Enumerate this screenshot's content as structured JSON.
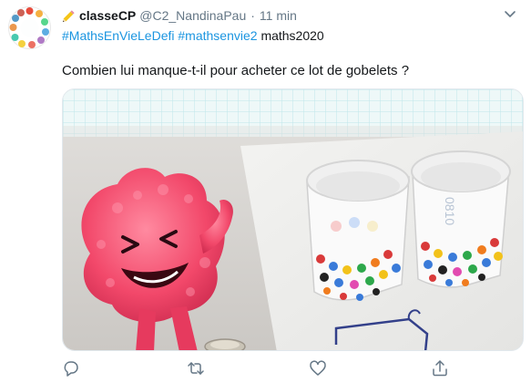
{
  "tweet": {
    "display_name": "classeCP",
    "handle": "@C2_NandinaPau",
    "separator": "·",
    "time": "11 min",
    "hashtags": [
      "#MathsEnVieLeDefi",
      "#mathsenvie2",
      "maths2020"
    ],
    "text": "Combien lui manque-t-il pour acheter ce lot de gobelets ?"
  },
  "icons": {
    "avatar": "avatar",
    "name_emoji": "pencil-icon",
    "more": "chevron-down-icon",
    "reply": "reply-icon",
    "retweet": "retweet-icon",
    "like": "heart-icon",
    "share": "share-icon"
  },
  "colors": {
    "link": "#1b95e0",
    "muted": "#657786",
    "text": "#14171a",
    "pink_figure": "#f2486a"
  }
}
